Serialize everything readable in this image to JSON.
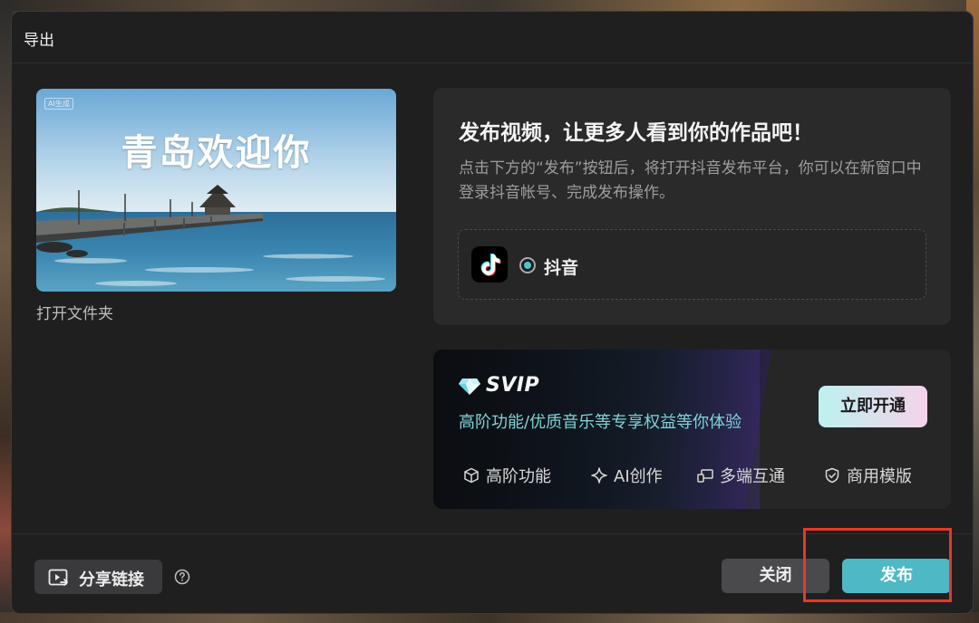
{
  "dialog": {
    "title": "导出"
  },
  "preview": {
    "ai_tag": "AI生成",
    "title_text": "青岛欢迎你",
    "open_folder": "打开文件夹"
  },
  "publish": {
    "headline": "发布视频，让更多人看到你的作品吧！",
    "description": "点击下方的“发布”按钮后，将打开抖音发布平台，你可以在新窗口中登录抖音帐号、完成发布操作。",
    "platform": {
      "name": "抖音",
      "selected": true,
      "icon": "tiktok-icon"
    }
  },
  "svip": {
    "label": "SVIP",
    "subtitle": "高阶功能/优质音乐等专享权益等你体验",
    "open_button": "立即开通",
    "features": [
      {
        "icon": "cube-icon",
        "label": "高阶功能"
      },
      {
        "icon": "sparkle-icon",
        "label": "AI创作"
      },
      {
        "icon": "devices-icon",
        "label": "多端互通"
      },
      {
        "icon": "shield-check-icon",
        "label": "商用模版"
      }
    ]
  },
  "footer": {
    "share_link": "分享链接",
    "close": "关闭",
    "publish": "发布"
  },
  "colors": {
    "accent": "#4fb8c5",
    "highlight": "#e23a2b",
    "dialog_bg": "#1f1f20"
  }
}
